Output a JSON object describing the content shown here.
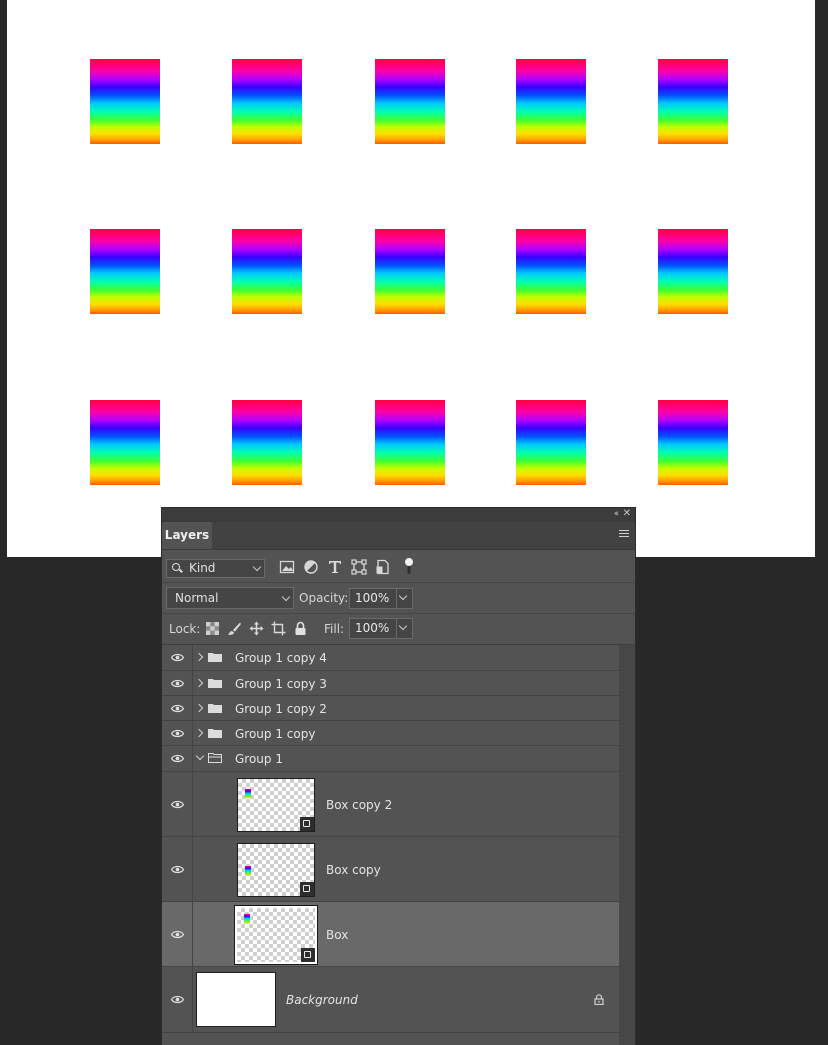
{
  "colors": {
    "app_background": "#282828",
    "panel": "#535353",
    "panel_dark": "#424242",
    "selected_row": "#696969",
    "document": "#ffffff"
  },
  "document": {
    "grid": {
      "rows": 3,
      "columns": 5
    },
    "object": "rainbow-gradient-box"
  },
  "panel": {
    "tab_label": "Layers",
    "collapse_icon": "double-chevron-left-icon",
    "close_icon": "close-icon",
    "menu_icon": "panel-menu-icon"
  },
  "filter": {
    "kind_label": "Kind",
    "icons": [
      "image-filter-icon",
      "adjustment-filter-icon",
      "type-filter-icon",
      "shape-filter-icon",
      "smart-object-filter-icon",
      "filter-toggle-icon"
    ]
  },
  "blend": {
    "mode": "Normal",
    "opacity_label": "Opacity:",
    "opacity": "100%",
    "fill_label": "Fill:",
    "fill": "100%"
  },
  "lock": {
    "label": "Lock:",
    "icons": [
      "lock-transparent-pixels-icon",
      "lock-image-pixels-icon",
      "lock-position-icon",
      "lock-artboard-icon",
      "lock-all-icon"
    ]
  },
  "layers": [
    {
      "name": "Group 1 copy 4",
      "type": "group",
      "expanded": false,
      "visible": true
    },
    {
      "name": "Group 1 copy 3",
      "type": "group",
      "expanded": false,
      "visible": true
    },
    {
      "name": "Group 1 copy 2",
      "type": "group",
      "expanded": false,
      "visible": true
    },
    {
      "name": "Group 1 copy",
      "type": "group",
      "expanded": false,
      "visible": true
    },
    {
      "name": "Group 1",
      "type": "group",
      "expanded": true,
      "visible": true
    },
    {
      "name": "Box copy 2",
      "type": "smart-object",
      "visible": true,
      "selected": false
    },
    {
      "name": "Box copy",
      "type": "smart-object",
      "visible": true,
      "selected": false
    },
    {
      "name": "Box",
      "type": "smart-object",
      "visible": true,
      "selected": true
    },
    {
      "name": "Background",
      "type": "background",
      "visible": true,
      "locked": true,
      "italic": true
    }
  ]
}
